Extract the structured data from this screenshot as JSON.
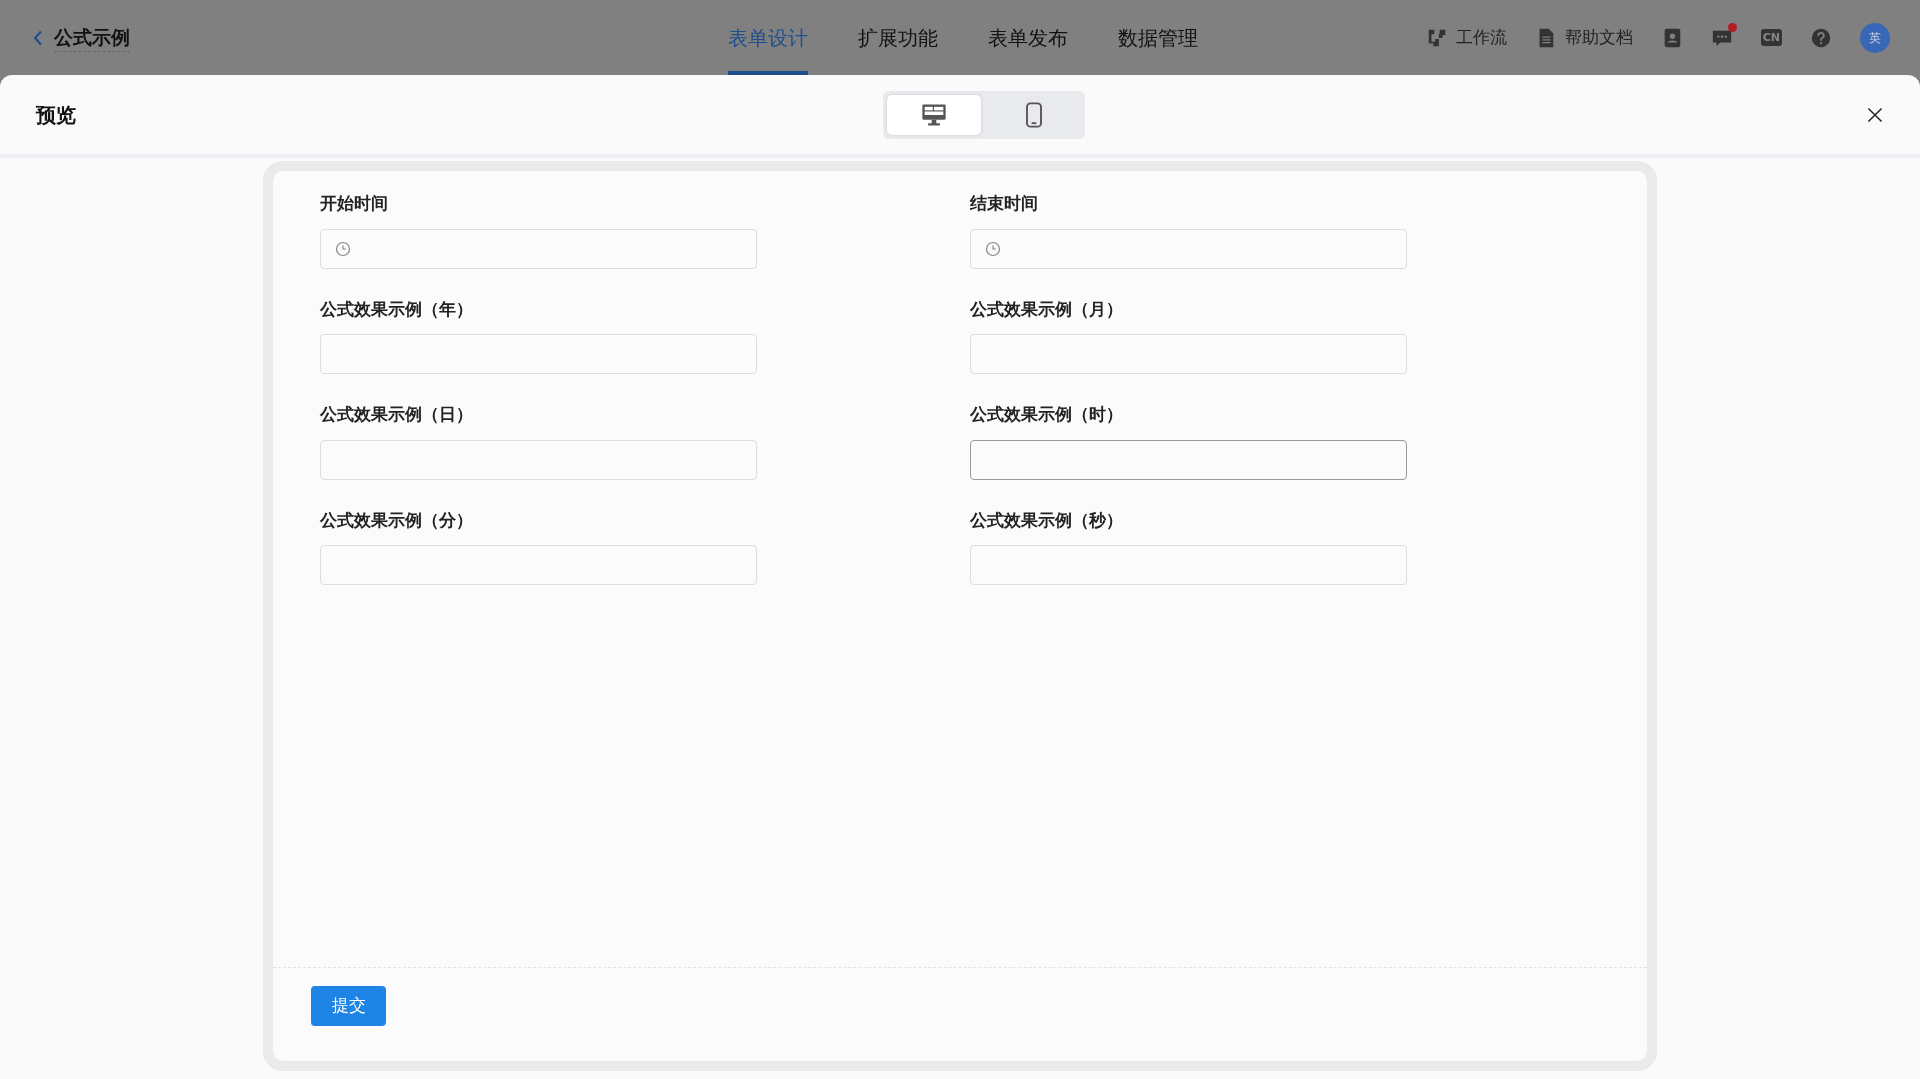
{
  "topbar": {
    "title": "公式示例",
    "tabs": [
      {
        "label": "表单设计",
        "selected": true
      },
      {
        "label": "扩展功能",
        "selected": false
      },
      {
        "label": "表单发布",
        "selected": false
      },
      {
        "label": "数据管理",
        "selected": false
      }
    ],
    "tools": [
      {
        "kind": "workflow",
        "label": "工作流"
      },
      {
        "kind": "docs",
        "label": "帮助文档"
      }
    ],
    "icons": [
      {
        "kind": "contacts",
        "unread": false
      },
      {
        "kind": "messages",
        "unread": true
      },
      {
        "kind": "language",
        "text": "CN",
        "unread": false
      },
      {
        "kind": "help",
        "unread": false
      }
    ],
    "avatar": "英"
  },
  "preview": {
    "title": "预览",
    "view_modes": [
      {
        "kind": "desktop",
        "selected": true
      },
      {
        "kind": "mobile",
        "selected": false
      }
    ],
    "fields": [
      {
        "label": "开始时间",
        "kind": "time",
        "hovered": false
      },
      {
        "label": "结束时间",
        "kind": "time",
        "hovered": false
      },
      {
        "label": "公式效果示例（年）",
        "kind": "text",
        "hovered": false
      },
      {
        "label": "公式效果示例（月）",
        "kind": "text",
        "hovered": false
      },
      {
        "label": "公式效果示例（日）",
        "kind": "text",
        "hovered": false
      },
      {
        "label": "公式效果示例（时）",
        "kind": "text",
        "hovered": true
      },
      {
        "label": "公式效果示例（分）",
        "kind": "text",
        "hovered": false
      },
      {
        "label": "公式效果示例（秒）",
        "kind": "text",
        "hovered": false
      }
    ],
    "submit": "提交"
  }
}
